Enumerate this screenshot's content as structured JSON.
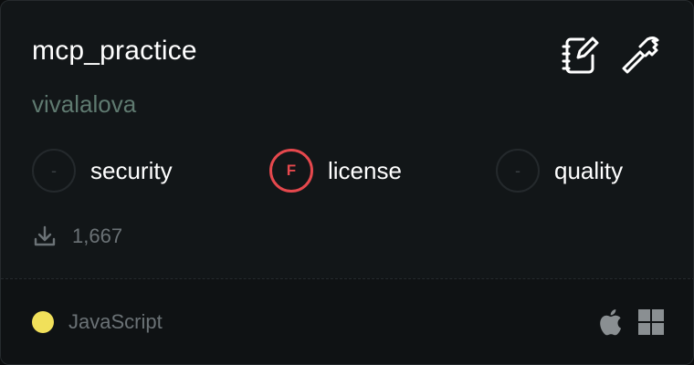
{
  "server": {
    "name": "mcp_practice",
    "owner": "vivalalova"
  },
  "header_icons": [
    "notebook-edit-icon",
    "hammer-icon"
  ],
  "scores": [
    {
      "label": "security",
      "grade": "-",
      "status": "none"
    },
    {
      "label": "license",
      "grade": "F",
      "status": "fail"
    },
    {
      "label": "quality",
      "grade": "-",
      "status": "none"
    }
  ],
  "downloads": {
    "icon": "download-icon",
    "count": "1,667"
  },
  "language": {
    "name": "JavaScript",
    "color": "#f1e05a"
  },
  "platforms": [
    "apple-icon",
    "windows-icon"
  ],
  "colors": {
    "fail": "#e5484d",
    "owner_text": "#5f7a70"
  }
}
